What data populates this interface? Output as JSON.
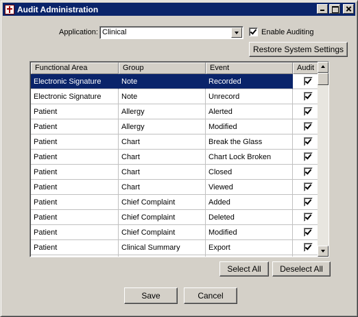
{
  "window": {
    "title": "Audit Administration"
  },
  "application": {
    "label": "Application:",
    "selected": "Clinical",
    "enable_auditing_label": "Enable Auditing",
    "enable_auditing_checked": true
  },
  "buttons": {
    "restore": "Restore System Settings",
    "select_all": "Select All",
    "deselect_all": "Deselect All",
    "save": "Save",
    "cancel": "Cancel"
  },
  "table": {
    "columns": [
      "Functional Area",
      "Group",
      "Event",
      "Audit"
    ],
    "selected_row": 0,
    "rows": [
      {
        "area": "Electronic Signature",
        "group": "Note",
        "event": "Recorded",
        "audit": true
      },
      {
        "area": "Electronic Signature",
        "group": "Note",
        "event": "Unrecord",
        "audit": true
      },
      {
        "area": "Patient",
        "group": "Allergy",
        "event": "Alerted",
        "audit": true
      },
      {
        "area": "Patient",
        "group": "Allergy",
        "event": "Modified",
        "audit": true
      },
      {
        "area": "Patient",
        "group": "Chart",
        "event": "Break the Glass",
        "audit": true
      },
      {
        "area": "Patient",
        "group": "Chart",
        "event": "Chart Lock Broken",
        "audit": true
      },
      {
        "area": "Patient",
        "group": "Chart",
        "event": "Closed",
        "audit": true
      },
      {
        "area": "Patient",
        "group": "Chart",
        "event": "Viewed",
        "audit": true
      },
      {
        "area": "Patient",
        "group": "Chief Complaint",
        "event": "Added",
        "audit": true
      },
      {
        "area": "Patient",
        "group": "Chief Complaint",
        "event": "Deleted",
        "audit": true
      },
      {
        "area": "Patient",
        "group": "Chief Complaint",
        "event": "Modified",
        "audit": true
      },
      {
        "area": "Patient",
        "group": "Clinical Summary",
        "event": "Export",
        "audit": true
      },
      {
        "area": "",
        "group": "",
        "event": "",
        "audit": false
      }
    ]
  },
  "colors": {
    "titlebar": "#0a246a",
    "face": "#d4d0c8",
    "selection": "#0a246a"
  },
  "icons": {
    "app": "caduceus-icon"
  }
}
